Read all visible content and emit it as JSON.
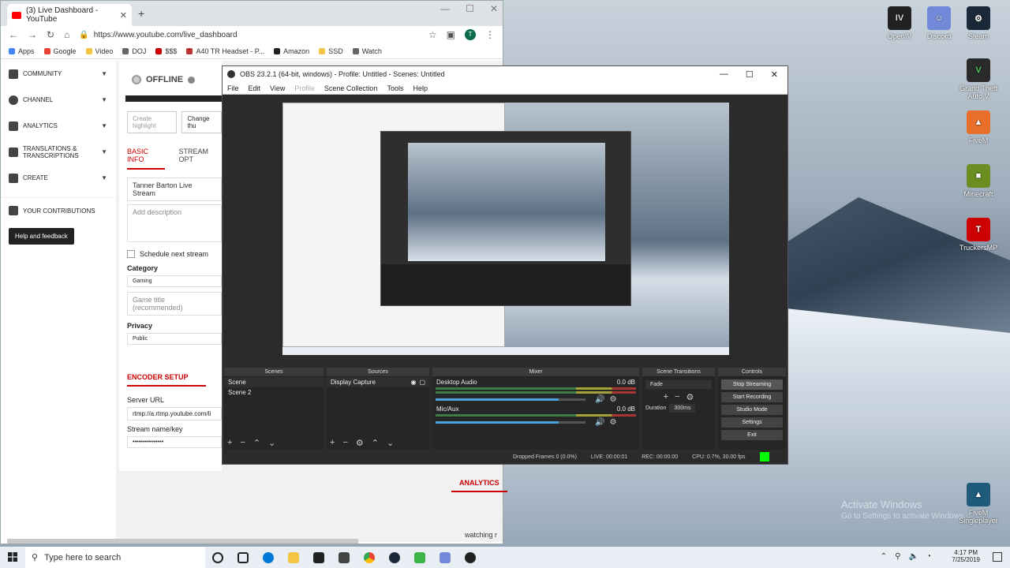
{
  "desktop": {
    "icons": [
      {
        "label": "OpenIV",
        "color": "#222"
      },
      {
        "label": "Discord",
        "color": "#7289da"
      },
      {
        "label": "Steam",
        "color": "#1b2838"
      },
      {
        "label": "Grand Theft Auto V",
        "color": "#2a2a2a"
      },
      {
        "label": "FiveM",
        "color": "#e8702a"
      },
      {
        "label": "Minecraft",
        "color": "#6b8e23"
      },
      {
        "label": "TruckersMP",
        "color": "#c00"
      },
      {
        "label": "FiveM Singleplayer",
        "color": "#1e5a7a"
      }
    ],
    "watermark_title": "Activate Windows",
    "watermark_sub": "Go to Settings to activate Windows."
  },
  "browser": {
    "tab_title": "(3) Live Dashboard - YouTube",
    "url": "https://www.youtube.com/live_dashboard",
    "bookmarks": [
      "Apps",
      "Google",
      "Video",
      "DOJ",
      "$$$",
      "A40 TR Headset - P...",
      "Amazon",
      "SSD",
      "Watch"
    ],
    "sidebar": [
      {
        "label": "COMMUNITY",
        "arrow": "▼"
      },
      {
        "label": "CHANNEL",
        "arrow": "▼"
      },
      {
        "label": "ANALYTICS",
        "arrow": "▼"
      },
      {
        "label": "TRANSLATIONS & TRANSCRIPTIONS",
        "arrow": "▼"
      },
      {
        "label": "CREATE",
        "arrow": "▼"
      },
      {
        "label": "YOUR CONTRIBUTIONS",
        "arrow": ""
      }
    ],
    "help_button": "Help and feedback",
    "status": "OFFLINE",
    "create_highlight": "Create highlight",
    "change_thumb": "Change thu",
    "tabs": [
      "BASIC INFO",
      "STREAM OPT"
    ],
    "stream_title": "Tanner Barton Live Stream",
    "description_placeholder": "Add description",
    "schedule_label": "Schedule next stream",
    "category_label": "Category",
    "category_value": "Gaming",
    "game_placeholder": "Game title (recommended)",
    "privacy_label": "Privacy",
    "privacy_value": "Public",
    "encoder_heading": "ENCODER SETUP",
    "server_url_label": "Server URL",
    "server_url_value": "rtmp://a.rtmp.youtube.com/li",
    "stream_key_label": "Stream name/key",
    "stream_key_value": "••••••••••••••••",
    "analytics_heading": "ANALYTICS",
    "watching": "watching r"
  },
  "obs": {
    "title": "OBS 23.2.1 (64-bit, windows) - Profile: Untitled - Scenes: Untitled",
    "menu": [
      "File",
      "Edit",
      "View",
      "Profile",
      "Scene Collection",
      "Tools",
      "Help"
    ],
    "docks": {
      "scenes": "Scenes",
      "sources": "Sources",
      "mixer": "Mixer",
      "transitions": "Scene Transitions",
      "controls": "Controls"
    },
    "scenes": [
      "Scene",
      "Scene 2"
    ],
    "sources": [
      "Display Capture"
    ],
    "mixer": [
      {
        "name": "Desktop Audio",
        "db": "0.0 dB",
        "level": 0.82
      },
      {
        "name": "Mic/Aux",
        "db": "0.0 dB",
        "level": 0.82
      }
    ],
    "transition": "Fade",
    "duration_label": "Duration",
    "duration_value": "300ms",
    "controls": [
      "Stop Streaming",
      "Start Recording",
      "Studio Mode",
      "Settings",
      "Exit"
    ],
    "status": {
      "dropped": "Dropped Frames 0 (0.0%)",
      "live": "LIVE: 00:00:01",
      "rec": "REC: 00:00:00",
      "cpu": "CPU: 0.7%, 30.00 fps"
    }
  },
  "taskbar": {
    "search_placeholder": "Type here to search",
    "time": "4:17 PM",
    "date": "7/25/2019"
  }
}
